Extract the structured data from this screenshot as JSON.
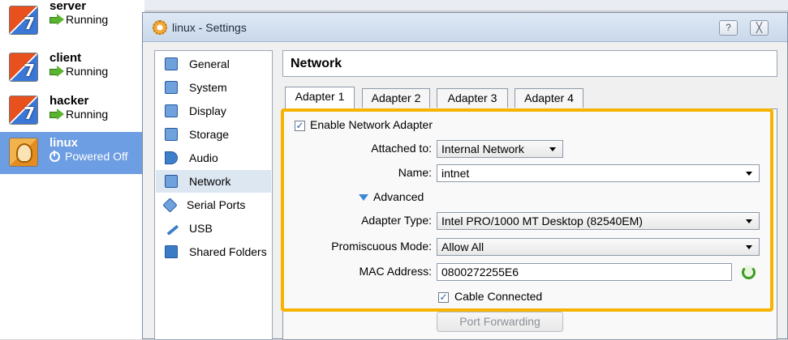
{
  "vm_list": [
    {
      "name": "server",
      "status": "Running"
    },
    {
      "name": "client",
      "status": "Running"
    },
    {
      "name": "hacker",
      "status": "Running"
    },
    {
      "name": "linux",
      "status": "Powered Off"
    }
  ],
  "dialog": {
    "title": "linux - Settings",
    "help_label": "?",
    "close_label": "╳"
  },
  "categories": [
    {
      "label": "General",
      "icon": "monitor-icon"
    },
    {
      "label": "System",
      "icon": "chip-icon"
    },
    {
      "label": "Display",
      "icon": "display-icon"
    },
    {
      "label": "Storage",
      "icon": "disk-icon"
    },
    {
      "label": "Audio",
      "icon": "speaker-icon"
    },
    {
      "label": "Network",
      "icon": "network-icon"
    },
    {
      "label": "Serial Ports",
      "icon": "serial-port-icon"
    },
    {
      "label": "USB",
      "icon": "usb-icon"
    },
    {
      "label": "Shared Folders",
      "icon": "folder-icon"
    }
  ],
  "selected_category": "Network",
  "section_title": "Network",
  "tabs": [
    "Adapter 1",
    "Adapter 2",
    "Adapter 3",
    "Adapter 4"
  ],
  "active_tab": "Adapter 1",
  "adapter": {
    "enable_label": "Enable Network Adapter",
    "enabled_mark": "✓",
    "attached_label": "Attached to:",
    "attached_value": "Internal Network",
    "name_label": "Name:",
    "name_value": "intnet",
    "advanced_label": "Advanced",
    "adapter_type_label": "Adapter Type:",
    "adapter_type_value": "Intel PRO/1000 MT Desktop (82540EM)",
    "promiscuous_label": "Promiscuous Mode:",
    "promiscuous_value": "Allow All",
    "mac_label": "MAC Address:",
    "mac_value": "0800272255E6",
    "cable_label": "Cable Connected",
    "cable_mark": "✓",
    "port_forwarding_label": "Port Forwarding"
  },
  "colors": {
    "highlight": "#f6b400",
    "selected_vm": "#6d9de2"
  }
}
